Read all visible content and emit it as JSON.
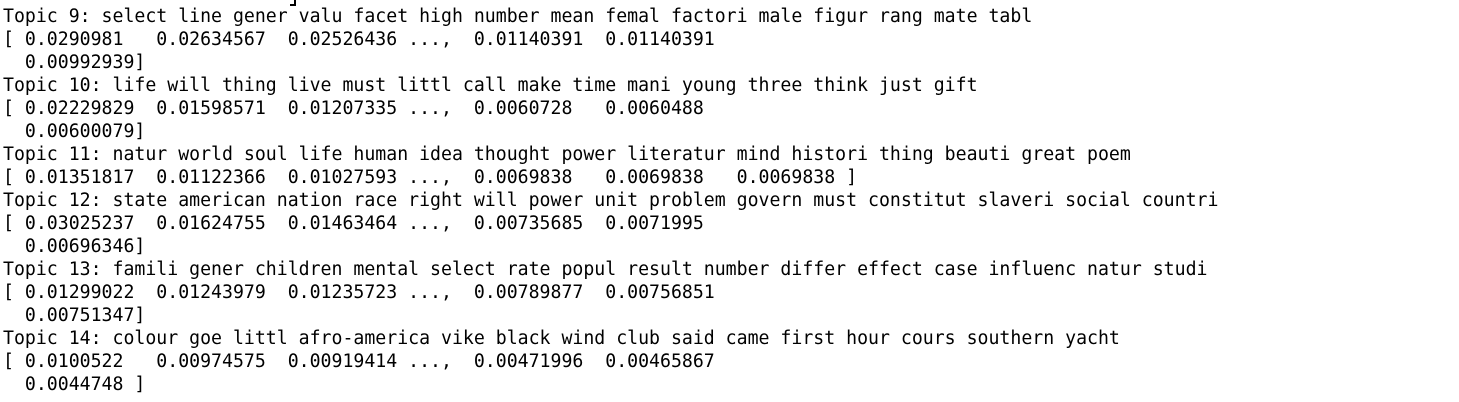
{
  "console": {
    "lines": [
      "Topic 9: select line gener valu facet high number mean femal factori male figur rang mate tabl",
      "[ 0.0290981   0.02634567  0.02526436 ...,  0.01140391  0.01140391",
      "  0.00992939]",
      "Topic 10: life will thing live must littl call make time mani young three think just gift",
      "[ 0.02229829  0.01598571  0.01207335 ...,  0.0060728   0.0060488",
      "  0.00600079]",
      "Topic 11: natur world soul life human idea thought power literatur mind histori thing beauti great poem",
      "[ 0.01351817  0.01122366  0.01027593 ...,  0.0069838   0.0069838   0.0069838 ]",
      "Topic 12: state american nation race right will power unit problem govern must constitut slaveri social countri",
      "[ 0.03025237  0.01624755  0.01463464 ...,  0.00735685  0.0071995",
      "  0.00696346]",
      "Topic 13: famili gener children mental select rate popul result number differ effect case influenc natur studi",
      "[ 0.01299022  0.01243979  0.01235723 ...,  0.00789877  0.00756851",
      "  0.00751347]",
      "Topic 14: colour goe littl afro-america vike black wind club said came first hour cours southern yacht",
      "[ 0.0100522   0.00974575  0.00919414 ...,  0.00471996  0.00465867",
      "  0.0044748 ]"
    ]
  }
}
